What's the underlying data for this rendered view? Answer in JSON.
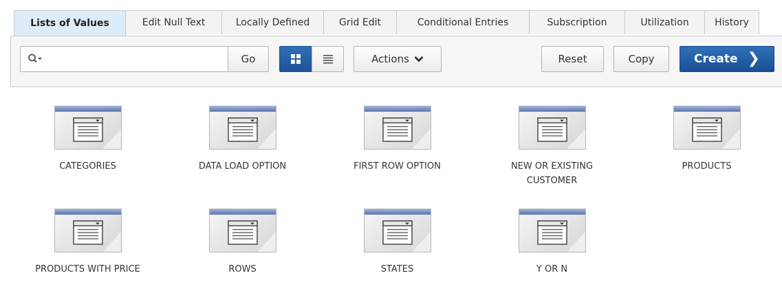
{
  "tabs": [
    {
      "label": "Lists of Values",
      "active": true
    },
    {
      "label": "Edit Null Text"
    },
    {
      "label": "Locally Defined"
    },
    {
      "label": "Grid Edit"
    },
    {
      "label": "Conditional Entries"
    },
    {
      "label": "Subscription"
    },
    {
      "label": "Utilization"
    },
    {
      "label": "History"
    }
  ],
  "toolbar": {
    "search_value": "",
    "go_label": "Go",
    "actions_label": "Actions",
    "reset_label": "Reset",
    "copy_label": "Copy",
    "create_label": "Create",
    "view_mode": "icons"
  },
  "items": [
    {
      "label": "CATEGORIES"
    },
    {
      "label": "DATA LOAD OPTION"
    },
    {
      "label": "FIRST ROW OPTION"
    },
    {
      "label": "NEW OR EXISTING CUSTOMER"
    },
    {
      "label": "PRODUCTS"
    },
    {
      "label": "PRODUCTS WITH PRICE"
    },
    {
      "label": "ROWS"
    },
    {
      "label": "STATES"
    },
    {
      "label": "Y OR N"
    }
  ],
  "icons": {
    "item": "list-of-values-icon"
  },
  "colors": {
    "accent": "#1d5497",
    "active_tab": "#dcecf9"
  }
}
